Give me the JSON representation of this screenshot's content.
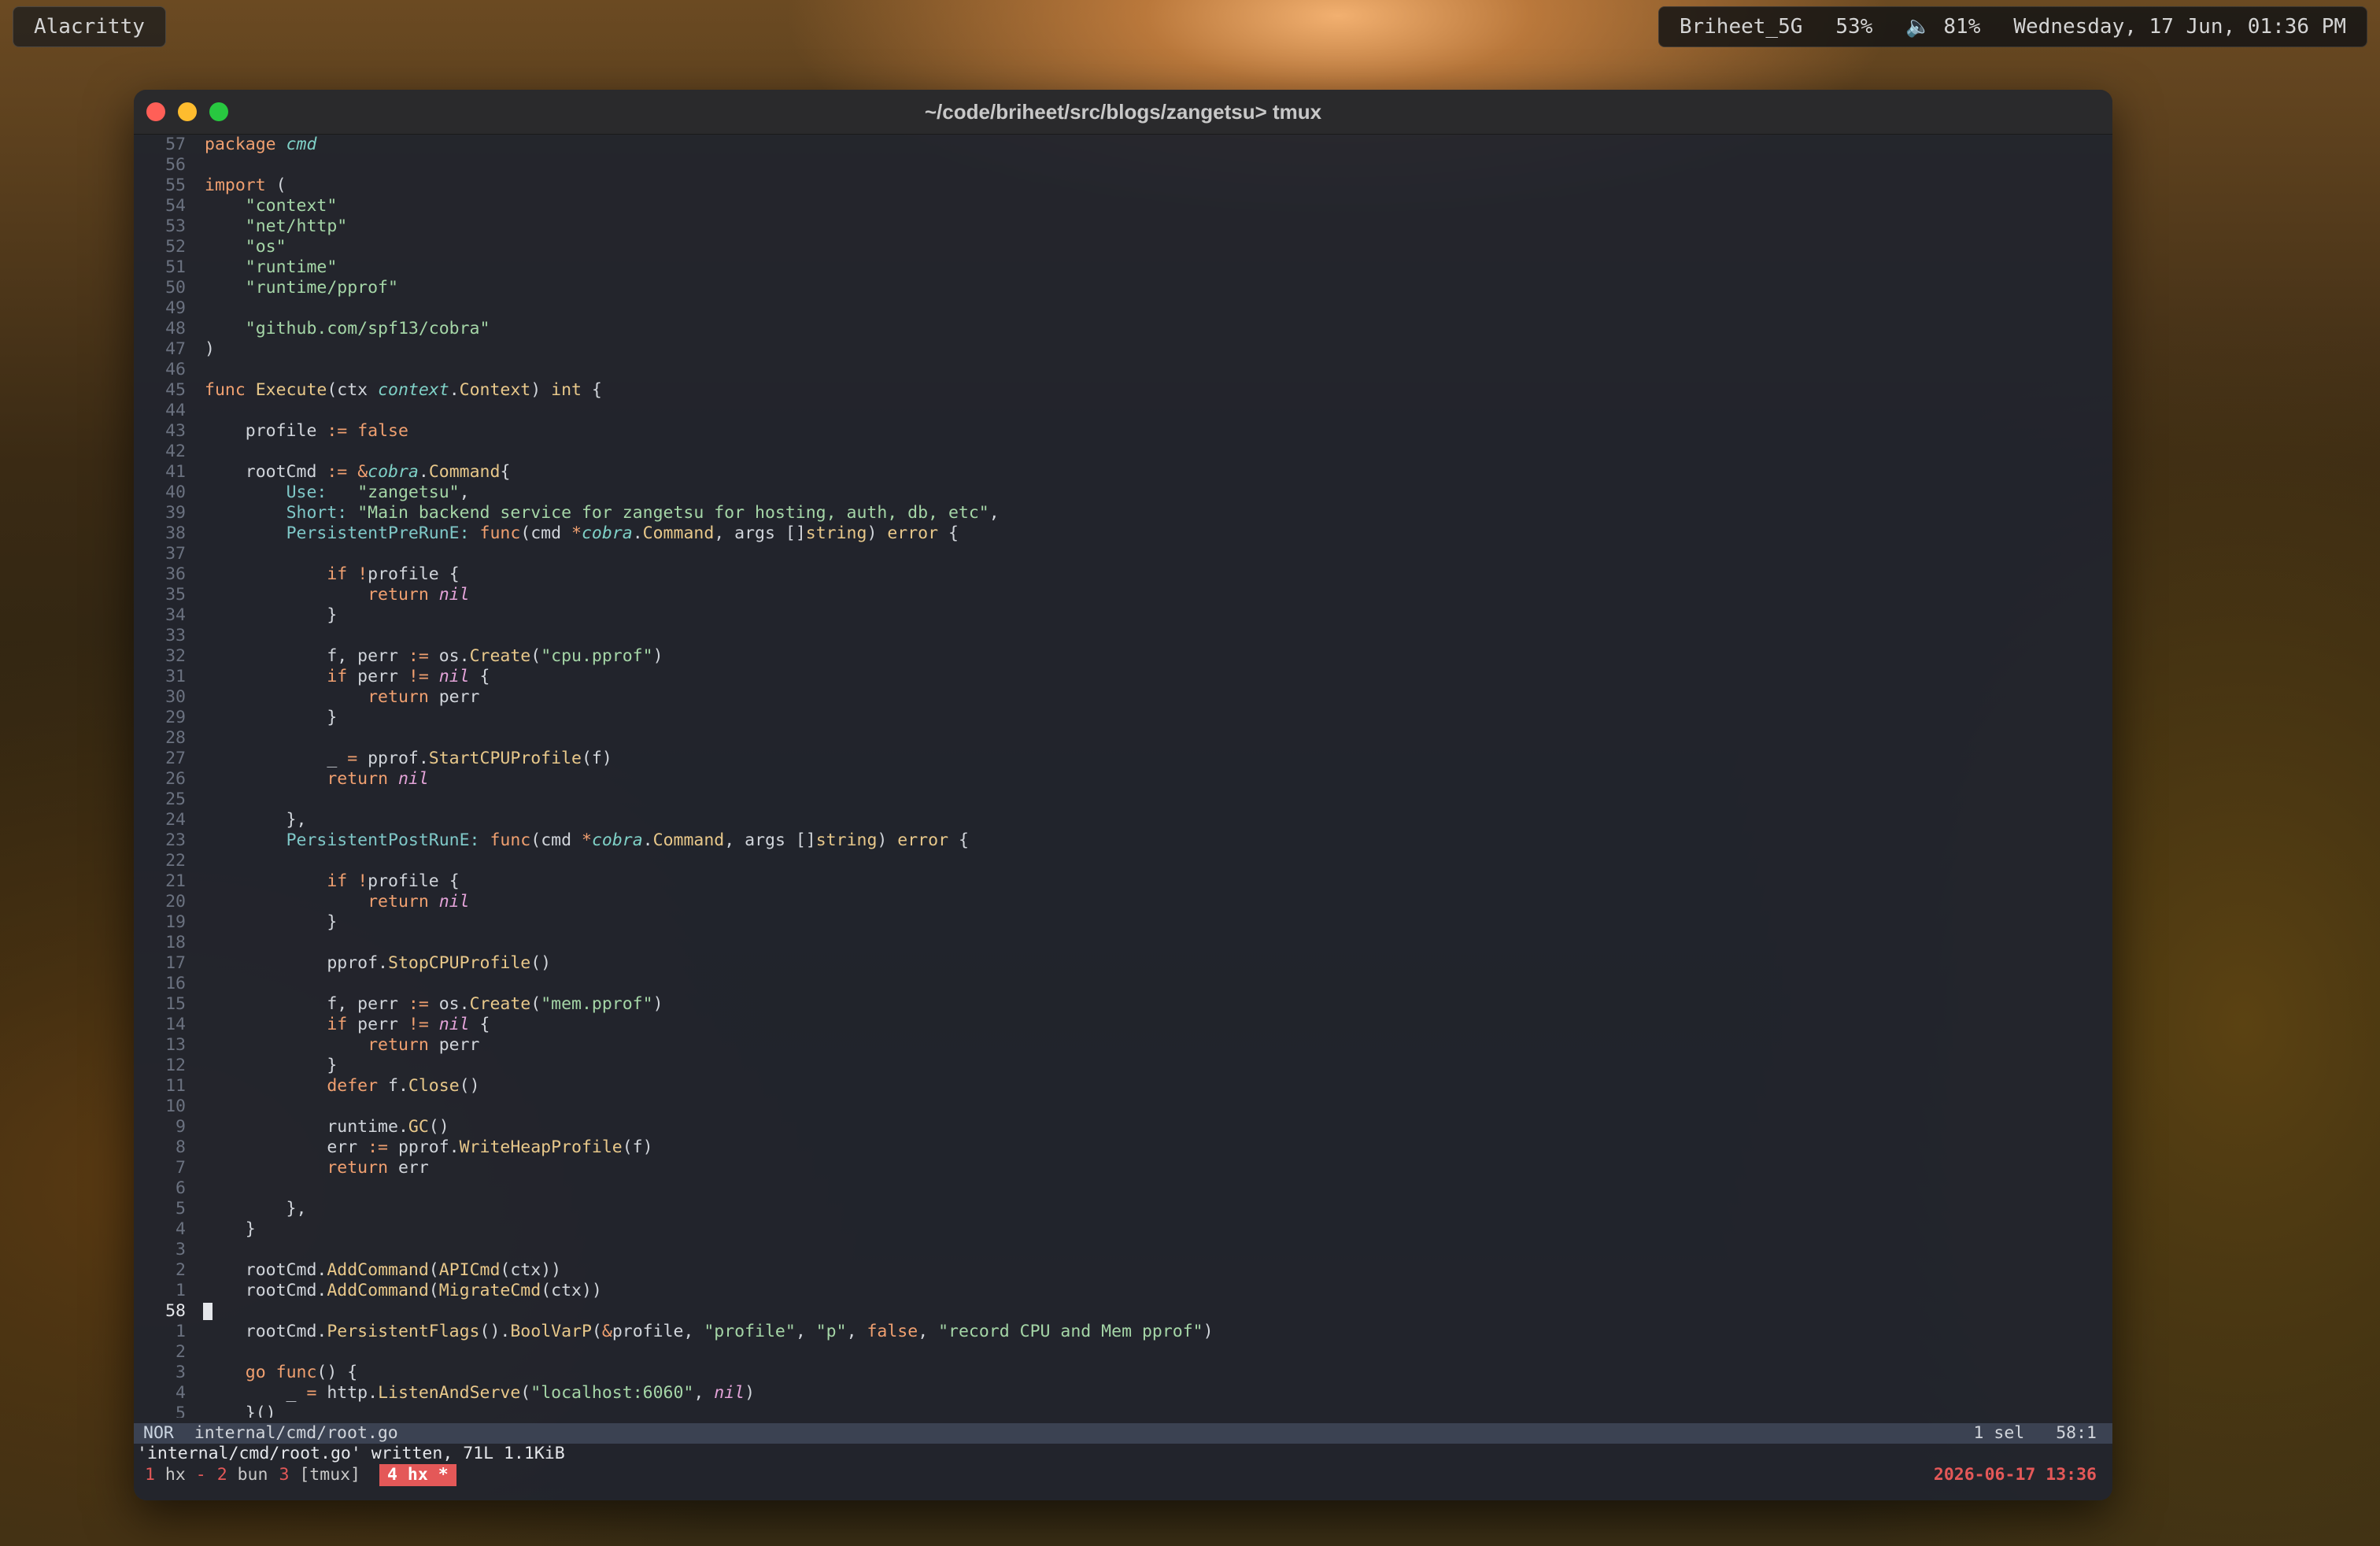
{
  "desktop": {
    "app_label": "Alacritty",
    "status": {
      "wifi": "Briheet_5G",
      "battery": "53%",
      "volume_icon": "speaker-icon",
      "volume": "81%",
      "datetime": "Wednesday, 17 Jun, 01:36 PM"
    }
  },
  "window": {
    "title": "~/code/briheet/src/blogs/zangetsu> tmux"
  },
  "editor": {
    "lines": [
      {
        "n": "57",
        "html": "<span class='kw'>package</span> <span class='ty'>cmd</span>"
      },
      {
        "n": "56",
        "html": ""
      },
      {
        "n": "55",
        "html": "<span class='kw'>import</span> ("
      },
      {
        "n": "54",
        "html": "    <span class='str'>\"context\"</span>"
      },
      {
        "n": "53",
        "html": "    <span class='str'>\"net/http\"</span>"
      },
      {
        "n": "52",
        "html": "    <span class='str'>\"os\"</span>"
      },
      {
        "n": "51",
        "html": "    <span class='str'>\"runtime\"</span>"
      },
      {
        "n": "50",
        "html": "    <span class='str'>\"runtime/pprof\"</span>"
      },
      {
        "n": "49",
        "html": ""
      },
      {
        "n": "48",
        "html": "    <span class='str'>\"github.com/spf13/cobra\"</span>"
      },
      {
        "n": "47",
        "html": ")"
      },
      {
        "n": "46",
        "html": ""
      },
      {
        "n": "45",
        "html": "<span class='kw'>func</span> <span class='fn'>Execute</span>(ctx <span class='ty'>context</span>.<span class='fn'>Context</span>) <span class='fn'>int</span> {"
      },
      {
        "n": "44",
        "html": ""
      },
      {
        "n": "43",
        "html": "    profile <span class='op'>:=</span> <span class='kw'>false</span>"
      },
      {
        "n": "42",
        "html": ""
      },
      {
        "n": "41",
        "html": "    rootCmd <span class='op'>:=</span> <span class='op'>&amp;</span><span class='ty'>cobra</span>.<span class='fn'>Command</span>{"
      },
      {
        "n": "40",
        "html": "        <span class='fld'>Use:</span>   <span class='str'>\"zangetsu\"</span>,"
      },
      {
        "n": "39",
        "html": "        <span class='fld'>Short:</span> <span class='str'>\"Main backend service for zangetsu for hosting, auth, db, etc\"</span>,"
      },
      {
        "n": "38",
        "html": "        <span class='fld'>PersistentPreRunE:</span> <span class='kw'>func</span>(cmd <span class='op'>*</span><span class='ty'>cobra</span>.<span class='fn'>Command</span>, args []<span class='fn'>string</span>) <span class='fn'>error</span> {"
      },
      {
        "n": "37",
        "html": ""
      },
      {
        "n": "36",
        "html": "            <span class='kw'>if</span> <span class='op'>!</span>profile {"
      },
      {
        "n": "35",
        "html": "                <span class='kw'>return</span> <span class='nil'>nil</span>"
      },
      {
        "n": "34",
        "html": "            }"
      },
      {
        "n": "33",
        "html": ""
      },
      {
        "n": "32",
        "html": "            f, perr <span class='op'>:=</span> os.<span class='fn'>Create</span>(<span class='str'>\"cpu.pprof\"</span>)"
      },
      {
        "n": "31",
        "html": "            <span class='kw'>if</span> perr <span class='op'>!=</span> <span class='nil'>nil</span> {"
      },
      {
        "n": "30",
        "html": "                <span class='kw'>return</span> perr"
      },
      {
        "n": "29",
        "html": "            }"
      },
      {
        "n": "28",
        "html": ""
      },
      {
        "n": "27",
        "html": "            _ <span class='op'>=</span> pprof.<span class='fn'>StartCPUProfile</span>(f)"
      },
      {
        "n": "26",
        "html": "            <span class='kw'>return</span> <span class='nil'>nil</span>"
      },
      {
        "n": "25",
        "html": ""
      },
      {
        "n": "24",
        "html": "        },"
      },
      {
        "n": "23",
        "html": "        <span class='fld'>PersistentPostRunE:</span> <span class='kw'>func</span>(cmd <span class='op'>*</span><span class='ty'>cobra</span>.<span class='fn'>Command</span>, args []<span class='fn'>string</span>) <span class='fn'>error</span> {"
      },
      {
        "n": "22",
        "html": ""
      },
      {
        "n": "21",
        "html": "            <span class='kw'>if</span> <span class='op'>!</span>profile {"
      },
      {
        "n": "20",
        "html": "                <span class='kw'>return</span> <span class='nil'>nil</span>"
      },
      {
        "n": "19",
        "html": "            }"
      },
      {
        "n": "18",
        "html": ""
      },
      {
        "n": "17",
        "html": "            pprof.<span class='fn'>StopCPUProfile</span>()"
      },
      {
        "n": "16",
        "html": ""
      },
      {
        "n": "15",
        "html": "            f, perr <span class='op'>:=</span> os.<span class='fn'>Create</span>(<span class='str'>\"mem.pprof\"</span>)"
      },
      {
        "n": "14",
        "html": "            <span class='kw'>if</span> perr <span class='op'>!=</span> <span class='nil'>nil</span> {"
      },
      {
        "n": "13",
        "html": "                <span class='kw'>return</span> perr"
      },
      {
        "n": "12",
        "html": "            }"
      },
      {
        "n": "11",
        "html": "            <span class='kw'>defer</span> f.<span class='fn'>Close</span>()"
      },
      {
        "n": "10",
        "html": ""
      },
      {
        "n": "9",
        "html": "            runtime.<span class='fn'>GC</span>()"
      },
      {
        "n": "8",
        "html": "            err <span class='op'>:=</span> pprof.<span class='fn'>WriteHeapProfile</span>(f)"
      },
      {
        "n": "7",
        "html": "            <span class='kw'>return</span> err"
      },
      {
        "n": "6",
        "html": ""
      },
      {
        "n": "5",
        "html": "        },"
      },
      {
        "n": "4",
        "html": "    }"
      },
      {
        "n": "3",
        "html": ""
      },
      {
        "n": "2",
        "html": "    rootCmd.<span class='fn'>AddCommand</span>(<span class='fn'>APICmd</span>(ctx))"
      },
      {
        "n": "1",
        "html": "    rootCmd.<span class='fn'>AddCommand</span>(<span class='fn'>MigrateCmd</span>(ctx))"
      },
      {
        "n": "58",
        "html": "",
        "cursor": true
      },
      {
        "n": "1",
        "html": "    rootCmd.<span class='fn'>PersistentFlags</span>().<span class='fn'>BoolVarP</span>(<span class='op'>&amp;</span>profile, <span class='str'>\"profile\"</span>, <span class='str'>\"p\"</span>, <span class='kw'>false</span>, <span class='str'>\"record CPU and Mem pprof\"</span>)"
      },
      {
        "n": "2",
        "html": ""
      },
      {
        "n": "3",
        "html": "    <span class='kw'>go</span> <span class='kw'>func</span>() {"
      },
      {
        "n": "4",
        "html": "        _ <span class='op'>=</span> http.<span class='fn'>ListenAndServe</span>(<span class='str'>\"localhost:6060\"</span>, <span class='nil'>nil</span>)"
      },
      {
        "n": "5",
        "html": "    }()"
      }
    ]
  },
  "modeline": {
    "mode": "NOR",
    "file": "internal/cmd/root.go",
    "selection": "1 sel",
    "position": "58:1"
  },
  "message": "'internal/cmd/root.go' written, 71L 1.1KiB",
  "tmux": {
    "windows": [
      {
        "index": "1",
        "name": "hx",
        "flag": "-"
      },
      {
        "index": "2",
        "name": "bun",
        "flag": ""
      },
      {
        "index": "3",
        "name": "[tmux]",
        "flag": ""
      }
    ],
    "active": "4 hx *",
    "datetime": "2026-06-17 13:36"
  }
}
